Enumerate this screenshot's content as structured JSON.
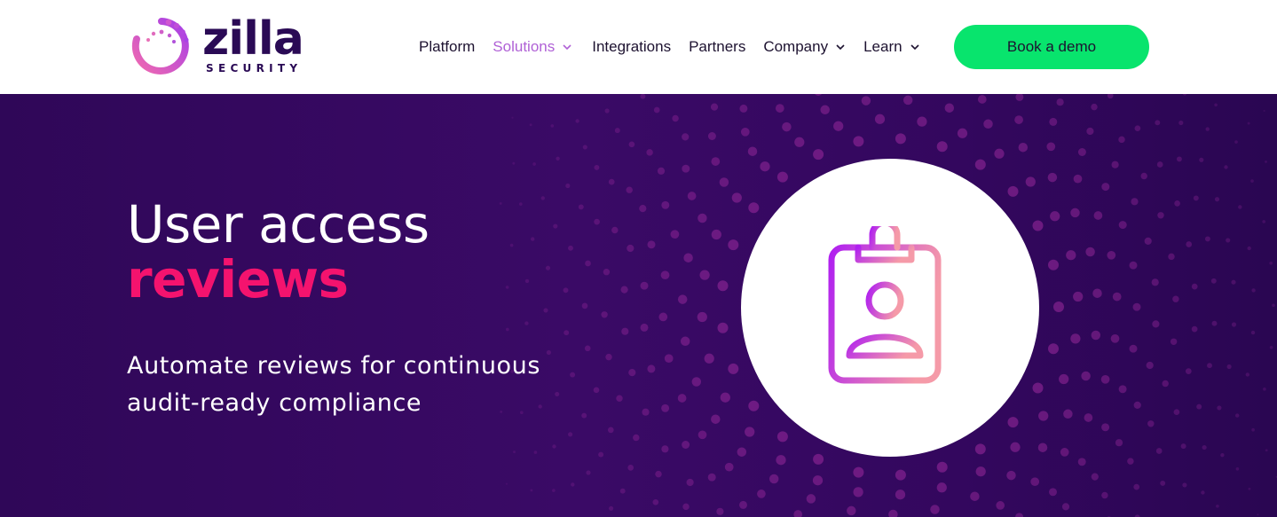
{
  "brand": {
    "name": "zilla",
    "tagline": "SECURITY"
  },
  "nav": {
    "items": [
      {
        "label": "Platform",
        "has_dropdown": false,
        "active": false
      },
      {
        "label": "Solutions",
        "has_dropdown": true,
        "active": true
      },
      {
        "label": "Integrations",
        "has_dropdown": false,
        "active": false
      },
      {
        "label": "Partners",
        "has_dropdown": false,
        "active": false
      },
      {
        "label": "Company",
        "has_dropdown": true,
        "active": false
      },
      {
        "label": "Learn",
        "has_dropdown": true,
        "active": false
      }
    ],
    "cta_label": "Book a demo"
  },
  "hero": {
    "title_line1": "User access",
    "title_line2": "reviews",
    "subtitle_line1": "Automate reviews for continuous",
    "subtitle_line2": "audit-ready compliance",
    "icon": "clipboard-user-icon"
  },
  "colors": {
    "brand_dark": "#2a0a55",
    "nav_active": "#b061d6",
    "cta_bg": "#08e46d",
    "hero_bg": "#3a0a66",
    "accent_pink": "#f4136e",
    "icon_gradient_start": "#b020f0",
    "icon_gradient_end": "#f59aa8"
  }
}
